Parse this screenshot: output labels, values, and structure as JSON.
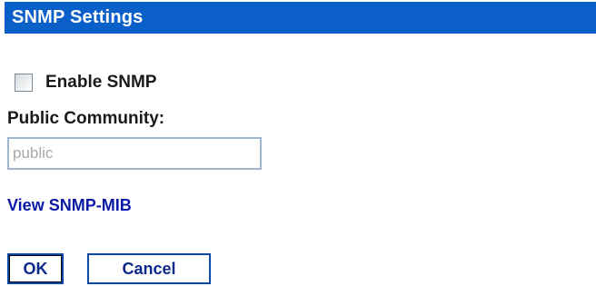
{
  "header": {
    "title": "SNMP Settings"
  },
  "snmp": {
    "enable_label": "Enable SNMP",
    "enabled": false
  },
  "community": {
    "label": "Public Community:",
    "value": "public"
  },
  "links": {
    "view_mib": "View SNMP-MIB"
  },
  "buttons": {
    "ok": "OK",
    "cancel": "Cancel"
  },
  "colors": {
    "header_bg": "#0a5fc8",
    "link": "#0b1aa6",
    "button_border": "#0a4aa4"
  }
}
